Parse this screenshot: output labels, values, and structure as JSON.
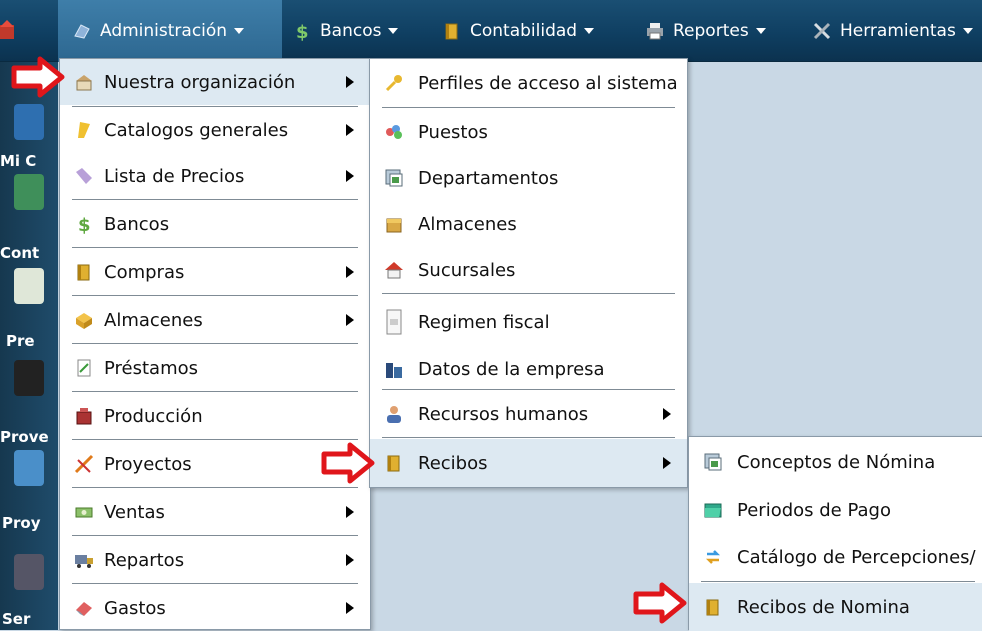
{
  "menubar": {
    "items": [
      {
        "label": "Administración",
        "icon": "gear-icon"
      },
      {
        "label": "Bancos",
        "icon": "dollar-icon"
      },
      {
        "label": "Contabilidad",
        "icon": "book-icon"
      },
      {
        "label": "Reportes",
        "icon": "printer-icon"
      },
      {
        "label": "Herramientas",
        "icon": "tools-icon"
      }
    ]
  },
  "desktop": {
    "labels": [
      "Mi C",
      "Cont",
      "Pre",
      "Prove",
      "Proy",
      "Ser"
    ]
  },
  "menu1": {
    "items": [
      {
        "label": "Nuestra organización",
        "icon": "building-icon",
        "submenu": true
      },
      {
        "label": "Catalogos generales",
        "icon": "folder-icon",
        "submenu": true
      },
      {
        "label": "Lista de Precios",
        "icon": "tag-icon",
        "submenu": true
      },
      {
        "label": "Bancos",
        "icon": "dollar-icon",
        "submenu": false
      },
      {
        "label": "Compras",
        "icon": "book-icon",
        "submenu": true
      },
      {
        "label": "Almacenes",
        "icon": "box-icon",
        "submenu": true
      },
      {
        "label": "Préstamos",
        "icon": "document-icon",
        "submenu": false
      },
      {
        "label": "Producción",
        "icon": "factory-icon",
        "submenu": false
      },
      {
        "label": "Proyectos",
        "icon": "pencil-icon",
        "submenu": false
      },
      {
        "label": "Ventas",
        "icon": "cash-icon",
        "submenu": true
      },
      {
        "label": "Repartos",
        "icon": "truck-icon",
        "submenu": true
      },
      {
        "label": "Gastos",
        "icon": "eraser-icon",
        "submenu": true
      }
    ]
  },
  "menu2": {
    "items": [
      {
        "label": "Perfiles de acceso al sistema",
        "icon": "key-icon",
        "submenu": false
      },
      {
        "label": "Puestos",
        "icon": "people-icon",
        "submenu": false
      },
      {
        "label": "Departamentos",
        "icon": "window-icon",
        "submenu": false
      },
      {
        "label": "Almacenes",
        "icon": "box-icon",
        "submenu": false
      },
      {
        "label": "Sucursales",
        "icon": "house-icon",
        "submenu": false
      },
      {
        "label": "Regimen fiscal",
        "icon": "document-icon",
        "submenu": false
      },
      {
        "label": "Datos de la empresa",
        "icon": "buildings-icon",
        "submenu": false
      },
      {
        "label": "Recursos humanos",
        "icon": "user-icon",
        "submenu": true
      },
      {
        "label": "Recibos",
        "icon": "book-icon",
        "submenu": true
      }
    ]
  },
  "menu3": {
    "items": [
      {
        "label": "Conceptos de Nómina",
        "icon": "window-icon"
      },
      {
        "label": "Periodos de Pago",
        "icon": "folder-open-icon"
      },
      {
        "label": "Catálogo de Percepciones/",
        "icon": "exchange-icon"
      },
      {
        "label": "Recibos de Nomina",
        "icon": "book-icon"
      }
    ]
  },
  "colors": {
    "menubar": "#0f3f62",
    "highlight": "#dde9f2",
    "arrow": "#e0161b"
  }
}
